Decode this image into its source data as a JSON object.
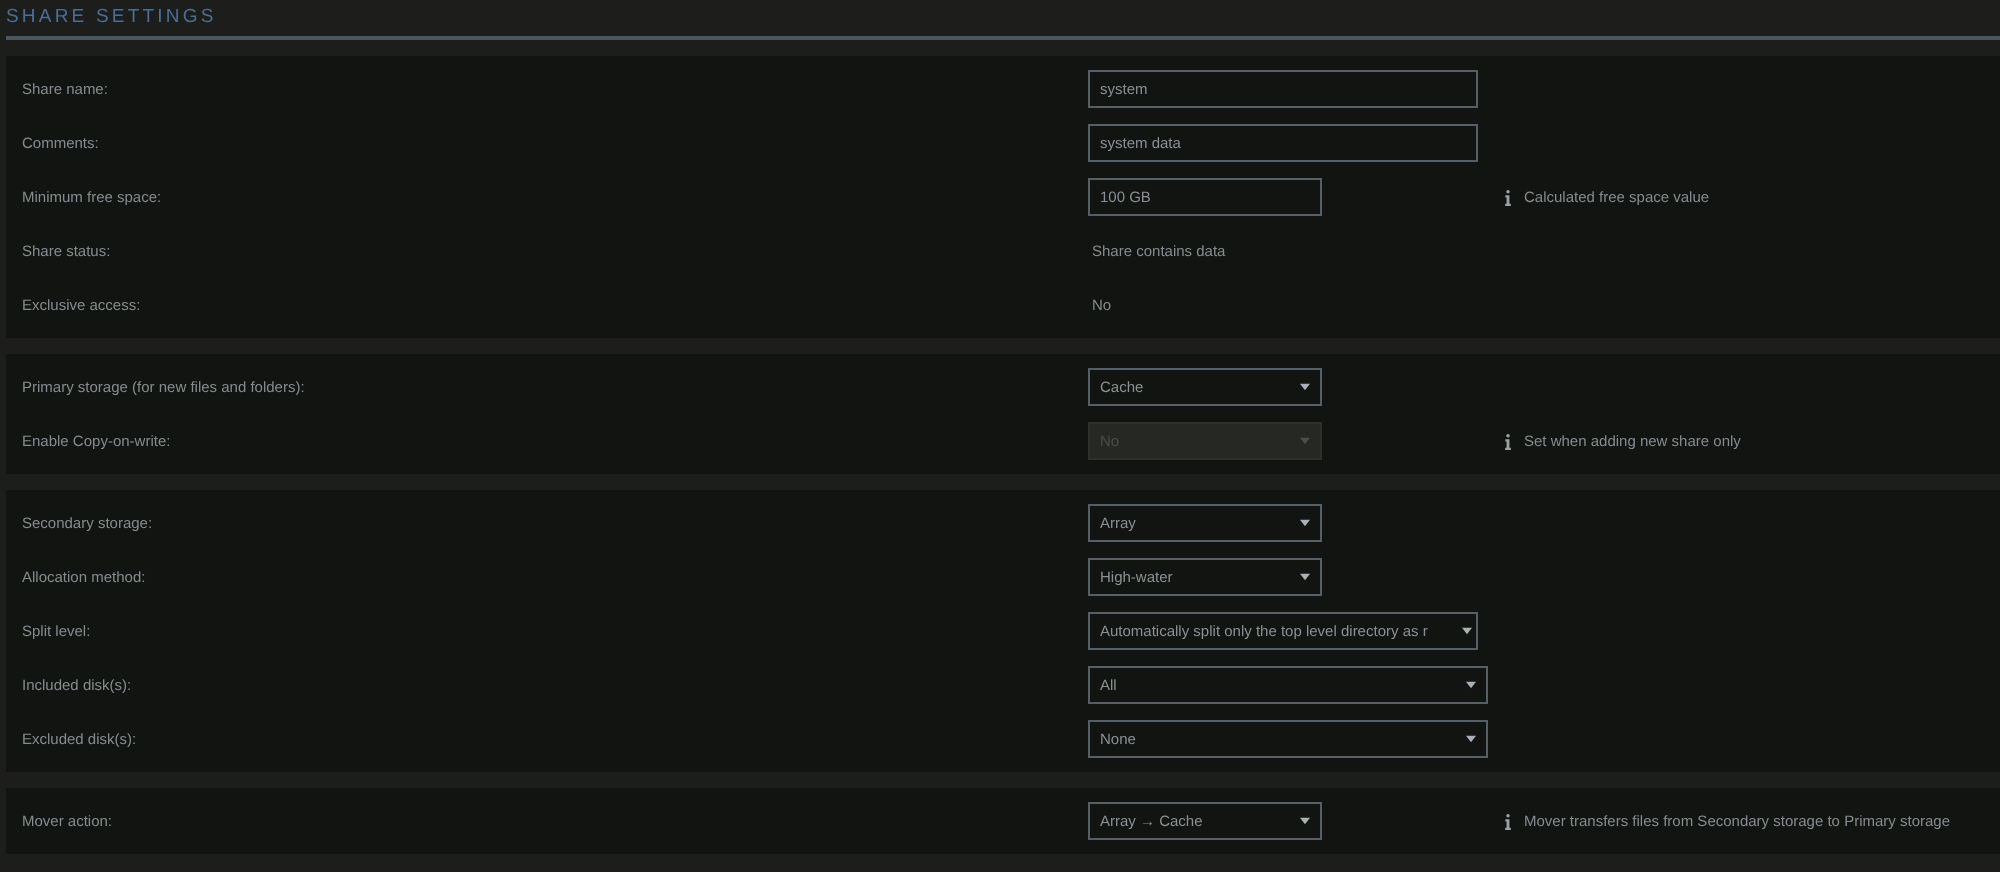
{
  "title": "SHARE SETTINGS",
  "sections": [
    {
      "rows": [
        {
          "label": "Share name:",
          "kind": "text",
          "value": "system"
        },
        {
          "label": "Comments:",
          "kind": "text",
          "value": "system data"
        },
        {
          "label": "Minimum free space:",
          "kind": "text",
          "value": "100 GB",
          "info": "Calculated free space value"
        },
        {
          "label": "Share status:",
          "kind": "static",
          "value": "Share contains data"
        },
        {
          "label": "Exclusive access:",
          "kind": "static",
          "value": "No"
        }
      ]
    },
    {
      "rows": [
        {
          "label": "Primary storage (for new files and folders):",
          "kind": "select",
          "value": "Cache",
          "disabled": false
        },
        {
          "label": "Enable Copy-on-write:",
          "kind": "select",
          "value": "No",
          "disabled": true,
          "info": "Set when adding new share only"
        }
      ]
    },
    {
      "rows": [
        {
          "label": "Secondary storage:",
          "kind": "select",
          "value": "Array",
          "disabled": false
        },
        {
          "label": "Allocation method:",
          "kind": "select",
          "value": "High-water",
          "disabled": false
        },
        {
          "label": "Split level:",
          "kind": "select",
          "value": "Automatically split only the top level directory as r",
          "disabled": false
        },
        {
          "label": "Included disk(s):",
          "kind": "select",
          "value": "All",
          "disabled": false
        },
        {
          "label": "Excluded disk(s):",
          "kind": "select",
          "value": "None",
          "disabled": false
        }
      ]
    },
    {
      "rows": [
        {
          "label": "Mover action:",
          "kind": "select",
          "value": "Array → Cache",
          "disabled": false,
          "info": "Mover transfers files from Secondary storage to Primary storage"
        }
      ]
    }
  ]
}
